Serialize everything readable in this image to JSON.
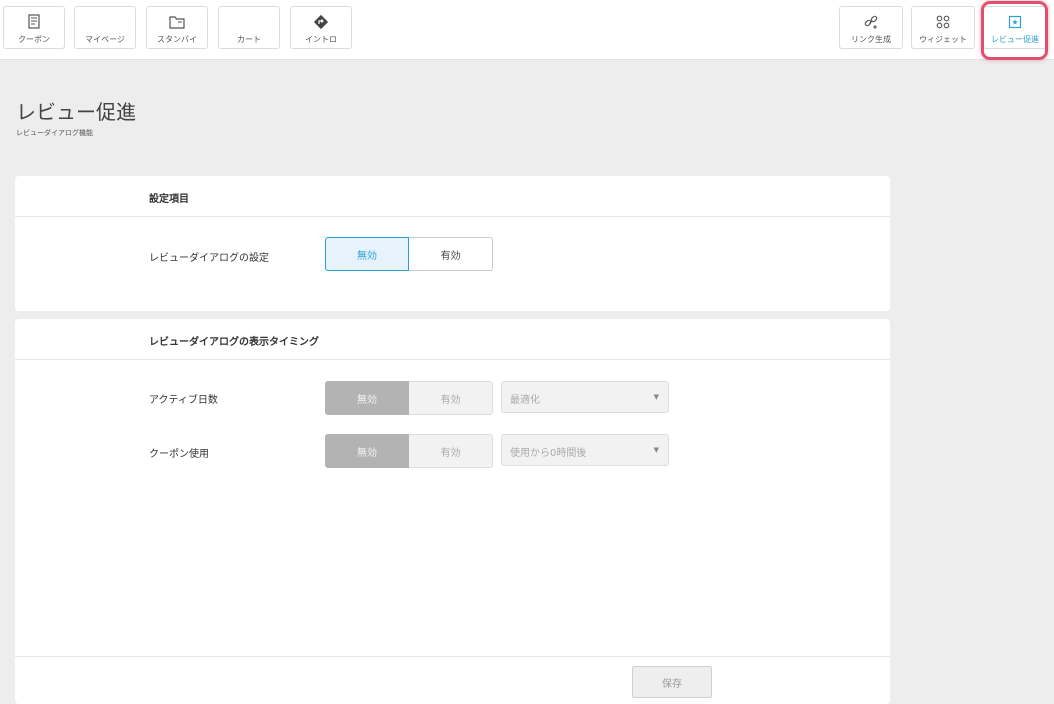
{
  "nav_left": [
    {
      "label": "クーポン",
      "icon": "receipt-icon"
    },
    {
      "label": "マイページ",
      "icon": "user-icon"
    },
    {
      "label": "スタンバイ",
      "icon": "folder-icon"
    },
    {
      "label": "カート",
      "icon": "cart-icon"
    },
    {
      "label": "イントロ",
      "icon": "diamond-arrow-icon"
    }
  ],
  "nav_right": [
    {
      "label": "リンク生成",
      "icon": "link-icon"
    },
    {
      "label": "ウィジェット",
      "icon": "widget-grid-icon"
    },
    {
      "label": "レビュー促進",
      "icon": "review-icon",
      "active": true
    }
  ],
  "page": {
    "title": "レビュー促進",
    "subtitle": "レビューダイアログ機能"
  },
  "settings_card": {
    "heading": "設定項目",
    "row_label": "レビューダイアログの設定",
    "option_off": "無効",
    "option_on": "有効",
    "selected": "無効"
  },
  "timing_card": {
    "heading": "レビューダイアログの表示タイミング",
    "rows": [
      {
        "label": "アクティブ日数",
        "option_off": "無効",
        "option_on": "有効",
        "select_value": "最適化"
      },
      {
        "label": "クーポン使用",
        "option_off": "無効",
        "option_on": "有効",
        "select_value": "使用から0時間後"
      }
    ],
    "save_label": "保存"
  },
  "colors": {
    "accent": "#2a9fd8",
    "highlight": "#e0506e",
    "background": "#ededed"
  }
}
